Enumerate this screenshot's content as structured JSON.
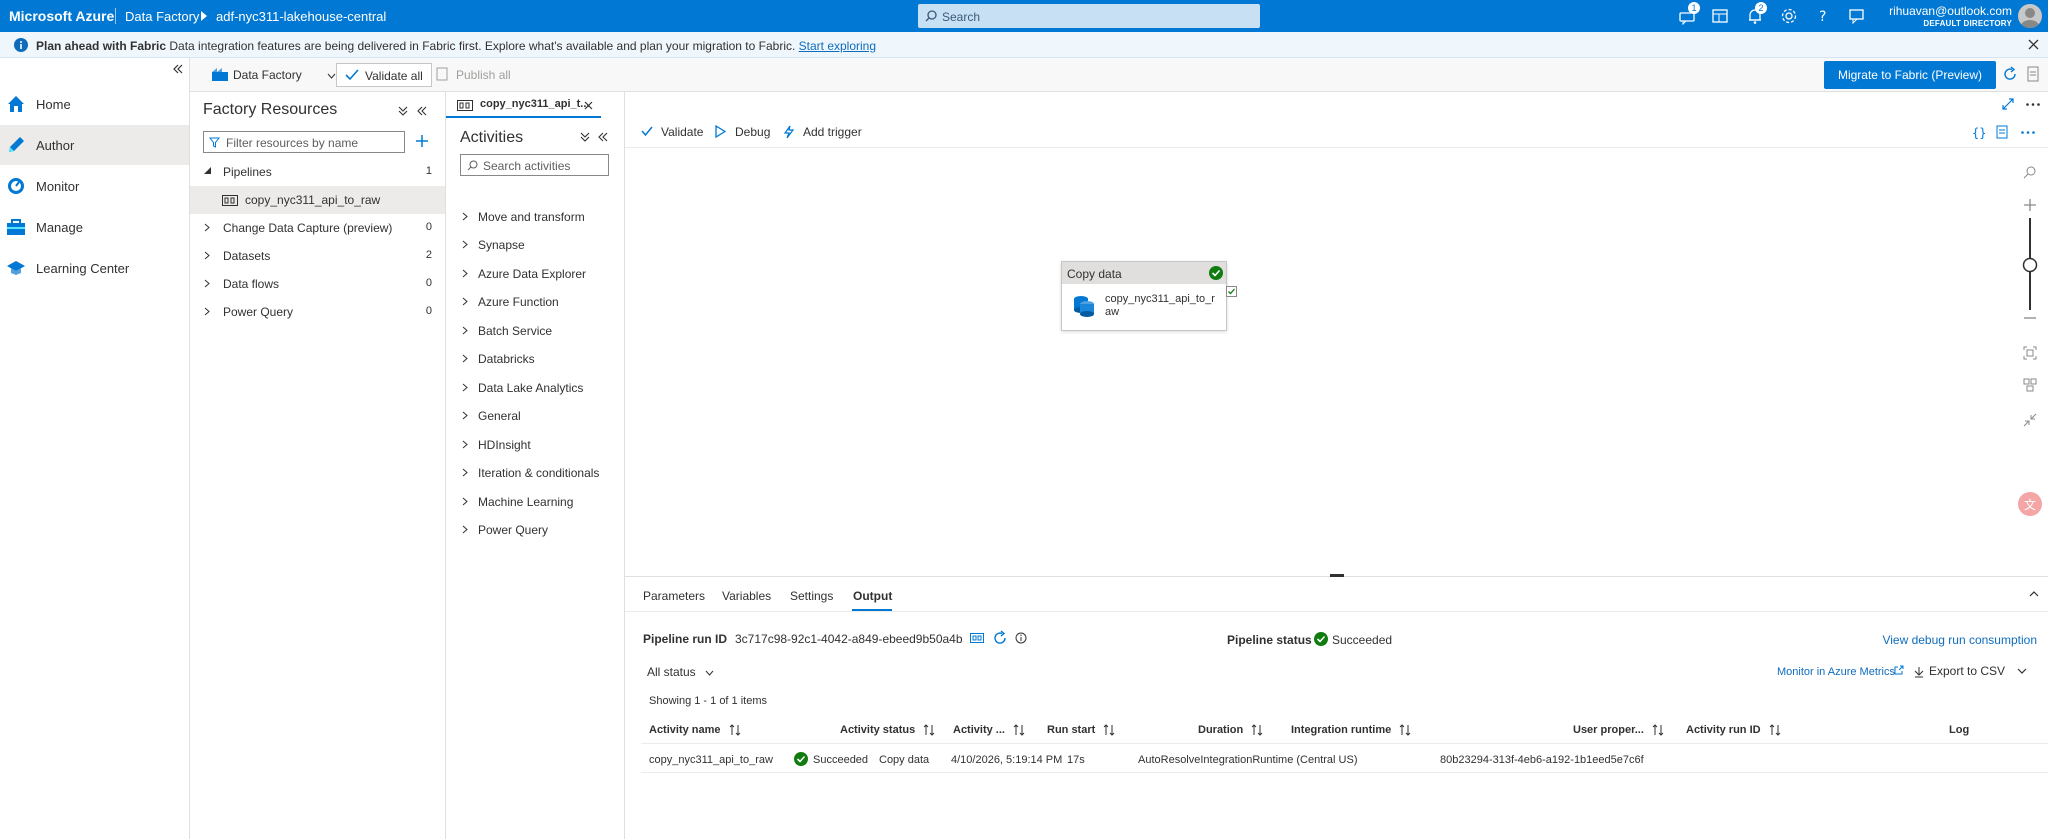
{
  "topbar": {
    "brand": "Microsoft Azure",
    "breadcrumb": [
      "Data Factory",
      "adf-nyc311-lakehouse-central"
    ],
    "search_placeholder": "Search",
    "badges": {
      "feedback": "1",
      "notifications": "2"
    },
    "user_name": "rihuavan@outlook.com",
    "user_directory": "DEFAULT DIRECTORY"
  },
  "banner": {
    "bold": "Plan ahead with Fabric",
    "text": " Data integration features are being delivered in Fabric first. Explore what's available and plan your migration to Fabric. ",
    "link": "Start exploring"
  },
  "leftnav": {
    "items": [
      {
        "label": "Home",
        "icon": "home-icon"
      },
      {
        "label": "Author",
        "icon": "pencil-icon",
        "active": true
      },
      {
        "label": "Monitor",
        "icon": "gauge-icon"
      },
      {
        "label": "Manage",
        "icon": "toolbox-icon"
      },
      {
        "label": "Learning Center",
        "icon": "graduation-cap-icon"
      }
    ]
  },
  "toolbar": {
    "factory_label": "Data Factory",
    "validate_all": "Validate all",
    "publish_all": "Publish all",
    "migrate": "Migrate to Fabric (Preview)"
  },
  "resources": {
    "title": "Factory Resources",
    "filter_placeholder": "Filter resources by name",
    "items": [
      {
        "label": "Pipelines",
        "count": "1",
        "expanded": true
      },
      {
        "label": "copy_nyc311_api_to_raw",
        "child": true,
        "selected": true
      },
      {
        "label": "Change Data Capture (preview)",
        "count": "0"
      },
      {
        "label": "Datasets",
        "count": "2"
      },
      {
        "label": "Data flows",
        "count": "0"
      },
      {
        "label": "Power Query",
        "count": "0"
      }
    ]
  },
  "tab": {
    "label": "copy_nyc311_api_t..."
  },
  "activities": {
    "title": "Activities",
    "search_placeholder": "Search activities",
    "items": [
      "Move and transform",
      "Synapse",
      "Azure Data Explorer",
      "Azure Function",
      "Batch Service",
      "Databricks",
      "Data Lake Analytics",
      "General",
      "HDInsight",
      "Iteration & conditionals",
      "Machine Learning",
      "Power Query"
    ]
  },
  "canvas_toolbar": {
    "validate": "Validate",
    "debug": "Debug",
    "add_trigger": "Add trigger"
  },
  "activity_card": {
    "type": "Copy data",
    "name": "copy_nyc311_api_to_raw",
    "status": "succeeded"
  },
  "output": {
    "tabs": [
      "Parameters",
      "Variables",
      "Settings",
      "Output"
    ],
    "active_tab": "Output",
    "run_id_label": "Pipeline run ID",
    "run_id": "3c717c98-92c1-4042-a849-ebeed9b50a4b",
    "status_label": "Pipeline status",
    "status": "Succeeded",
    "debug_link": "View debug run consumption",
    "filter": "All status",
    "monitor_link": "Monitor in Azure Metrics",
    "export": "Export to CSV",
    "showing": "Showing 1 - 1 of 1 items",
    "columns": [
      "Activity name",
      "Activity status",
      "Activity ...",
      "Run start",
      "Duration",
      "Integration runtime",
      "User proper...",
      "Activity run ID",
      "Log"
    ],
    "rows": [
      {
        "activity_name": "copy_nyc311_api_to_raw",
        "status": "Succeeded",
        "type": "Copy data",
        "run_start": "4/10/2026, 5:19:14 PM",
        "duration": "17s",
        "runtime": "AutoResolveIntegrationRuntime (Central US)",
        "user_props": "",
        "run_id": "80b23294-313f-4eb6-a192-1b1eed5e7c6f",
        "log": ""
      }
    ]
  },
  "colors": {
    "accent": "#0078d4",
    "success": "#107c10"
  }
}
